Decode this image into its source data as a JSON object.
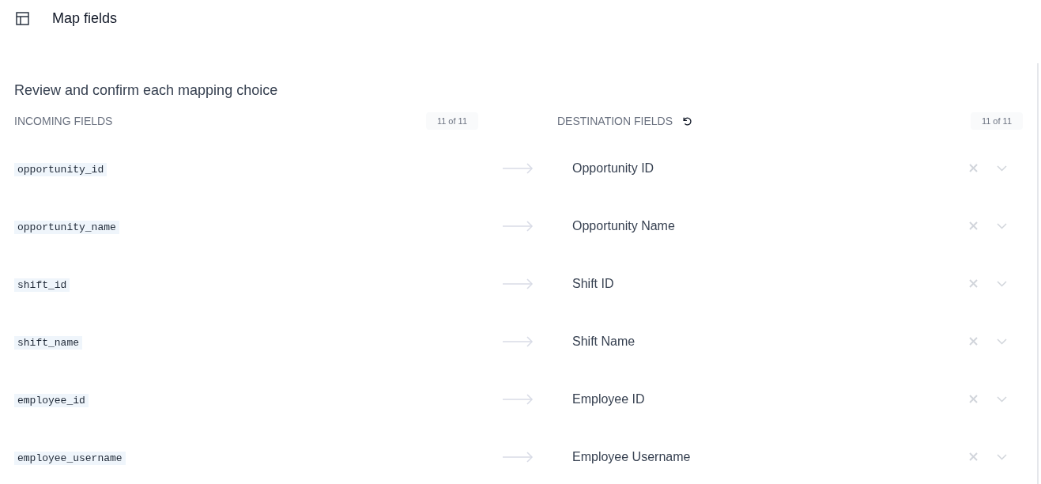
{
  "header": {
    "title": "Map fields"
  },
  "heading": "Review and confirm each mapping choice",
  "incoming": {
    "label": "INCOMING FIELDS",
    "count": "11 of 11"
  },
  "destination": {
    "label": "DESTINATION FIELDS",
    "count": "11 of 11"
  },
  "rows": [
    {
      "source": "opportunity_id",
      "target": "Opportunity ID"
    },
    {
      "source": "opportunity_name",
      "target": "Opportunity Name"
    },
    {
      "source": "shift_id",
      "target": "Shift ID"
    },
    {
      "source": "shift_name",
      "target": "Shift Name"
    },
    {
      "source": "employee_id",
      "target": "Employee ID"
    },
    {
      "source": "employee_username",
      "target": "Employee Username"
    }
  ]
}
